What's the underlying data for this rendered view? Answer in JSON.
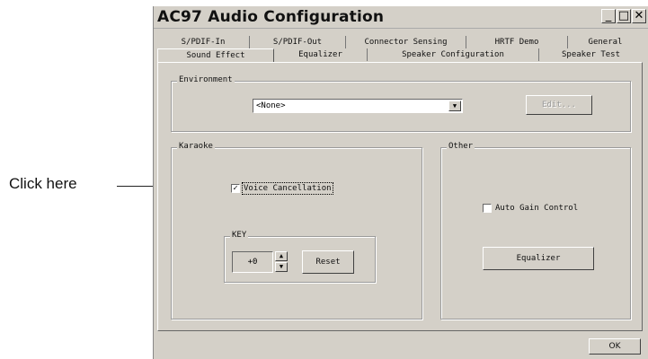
{
  "annotation": {
    "text": "Click here"
  },
  "window": {
    "title": "AC97 Audio Configuration",
    "controls": {
      "minimize": "_",
      "maximize": "□",
      "close": "✕"
    }
  },
  "tabs": {
    "row_back": [
      "S/PDIF-In",
      "S/PDIF-Out",
      "Connector Sensing",
      "HRTF Demo",
      "General"
    ],
    "row_front": [
      "Sound Effect",
      "Equalizer",
      "Speaker Configuration",
      "Speaker Test"
    ],
    "active": "Sound Effect"
  },
  "environment": {
    "legend": "Environment",
    "select_value": "<None>",
    "edit_button": "Edit..."
  },
  "karaoke": {
    "legend": "Karaoke",
    "voice_cancellation_label": "Voice Cancellation",
    "voice_cancellation_checked": true,
    "key": {
      "legend": "KEY",
      "value": "+0",
      "reset_button": "Reset"
    }
  },
  "other": {
    "legend": "Other",
    "auto_gain_label": "Auto Gain Control",
    "auto_gain_checked": false,
    "equalizer_button": "Equalizer"
  },
  "footer": {
    "ok_button": "OK"
  },
  "icons": {
    "dropdown": "chevron-down-icon",
    "spin_up": "spin-up-icon",
    "spin_down": "spin-down-icon",
    "check": "checkmark-icon"
  }
}
